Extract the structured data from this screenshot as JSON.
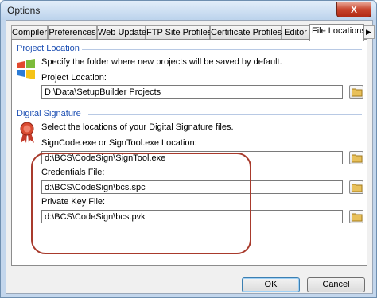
{
  "window": {
    "title": "Options",
    "close_glyph": "X"
  },
  "tabs": [
    {
      "label": "Compiler",
      "icon": "none"
    },
    {
      "label": "Preferences",
      "icon": "none"
    },
    {
      "label": "Web Update",
      "icon": "none"
    },
    {
      "label": "FTP Site Profiles",
      "icon": "none"
    },
    {
      "label": "Certificate Profiles",
      "icon": "none"
    },
    {
      "label": "Editor",
      "icon": "none"
    },
    {
      "label": "File Locations",
      "icon": "none"
    }
  ],
  "tab_scroll": {
    "left": "◀",
    "right": "▶"
  },
  "project_location": {
    "section_title": "Project Location",
    "description": "Specify the folder where new projects will be saved by default.",
    "field_label": "Project Location:",
    "value": "D:\\Data\\SetupBuilder Projects",
    "icon": "windows-logo-icon"
  },
  "digital_signature": {
    "section_title": "Digital Signature",
    "description": "Select the locations of your Digital Signature files.",
    "icon": "ribbon-seal-icon",
    "fields": [
      {
        "label": "SignCode.exe or SignTool.exe Location:",
        "value": "d:\\BCS\\CodeSign\\SignTool.exe"
      },
      {
        "label": "Credentials File:",
        "value": "d:\\BCS\\CodeSign\\bcs.spc"
      },
      {
        "label": "Private Key File:",
        "value": "d:\\BCS\\CodeSign\\bcs.pvk"
      }
    ]
  },
  "buttons": {
    "ok": "OK",
    "cancel": "Cancel"
  },
  "colors": {
    "section_title": "#1e50b4",
    "highlight_ring": "#a83a2c",
    "close_button": "#c7432b"
  }
}
